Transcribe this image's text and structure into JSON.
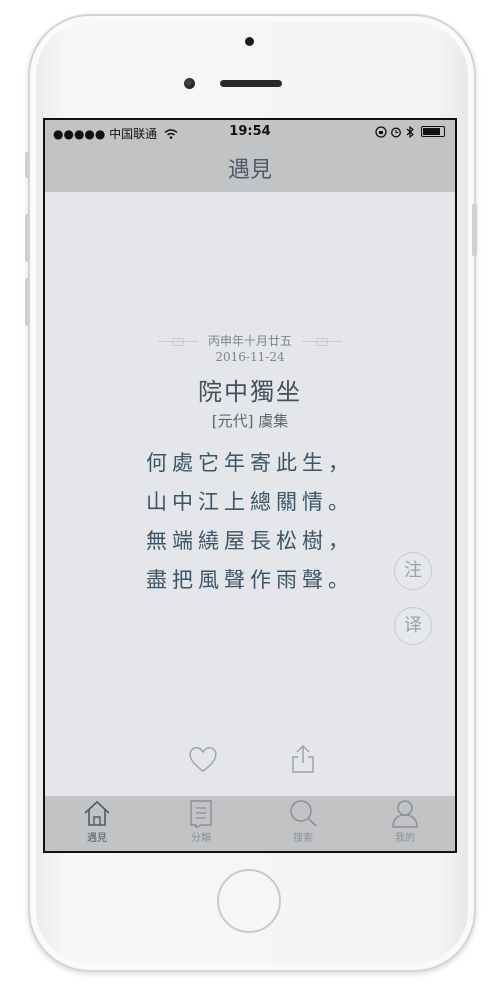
{
  "status_bar": {
    "carrier": "●●●●● 中国联通",
    "time": "19:54"
  },
  "nav": {
    "title": "遇見"
  },
  "poem": {
    "lunar_date": "丙申年十月廿五",
    "date": "2016-11-24",
    "title": "院中獨坐",
    "author": "[元代] 虞集",
    "verses": [
      "何處它年寄此生，",
      "山中江上總關情。",
      "無端繞屋長松樹，",
      "盡把風聲作雨聲。"
    ]
  },
  "side_buttons": {
    "notes": "注",
    "translate": "译"
  },
  "tabs": [
    {
      "label": "遇見",
      "icon": "home-icon"
    },
    {
      "label": "分類",
      "icon": "list-icon"
    },
    {
      "label": "搜索",
      "icon": "search-icon"
    },
    {
      "label": "我的",
      "icon": "profile-icon"
    }
  ],
  "colors": {
    "accent": "#4d5c69",
    "verse_text": "#3b5668",
    "bar_bg": "#c2c3c5",
    "screen_bg": "#e4e6e9"
  }
}
